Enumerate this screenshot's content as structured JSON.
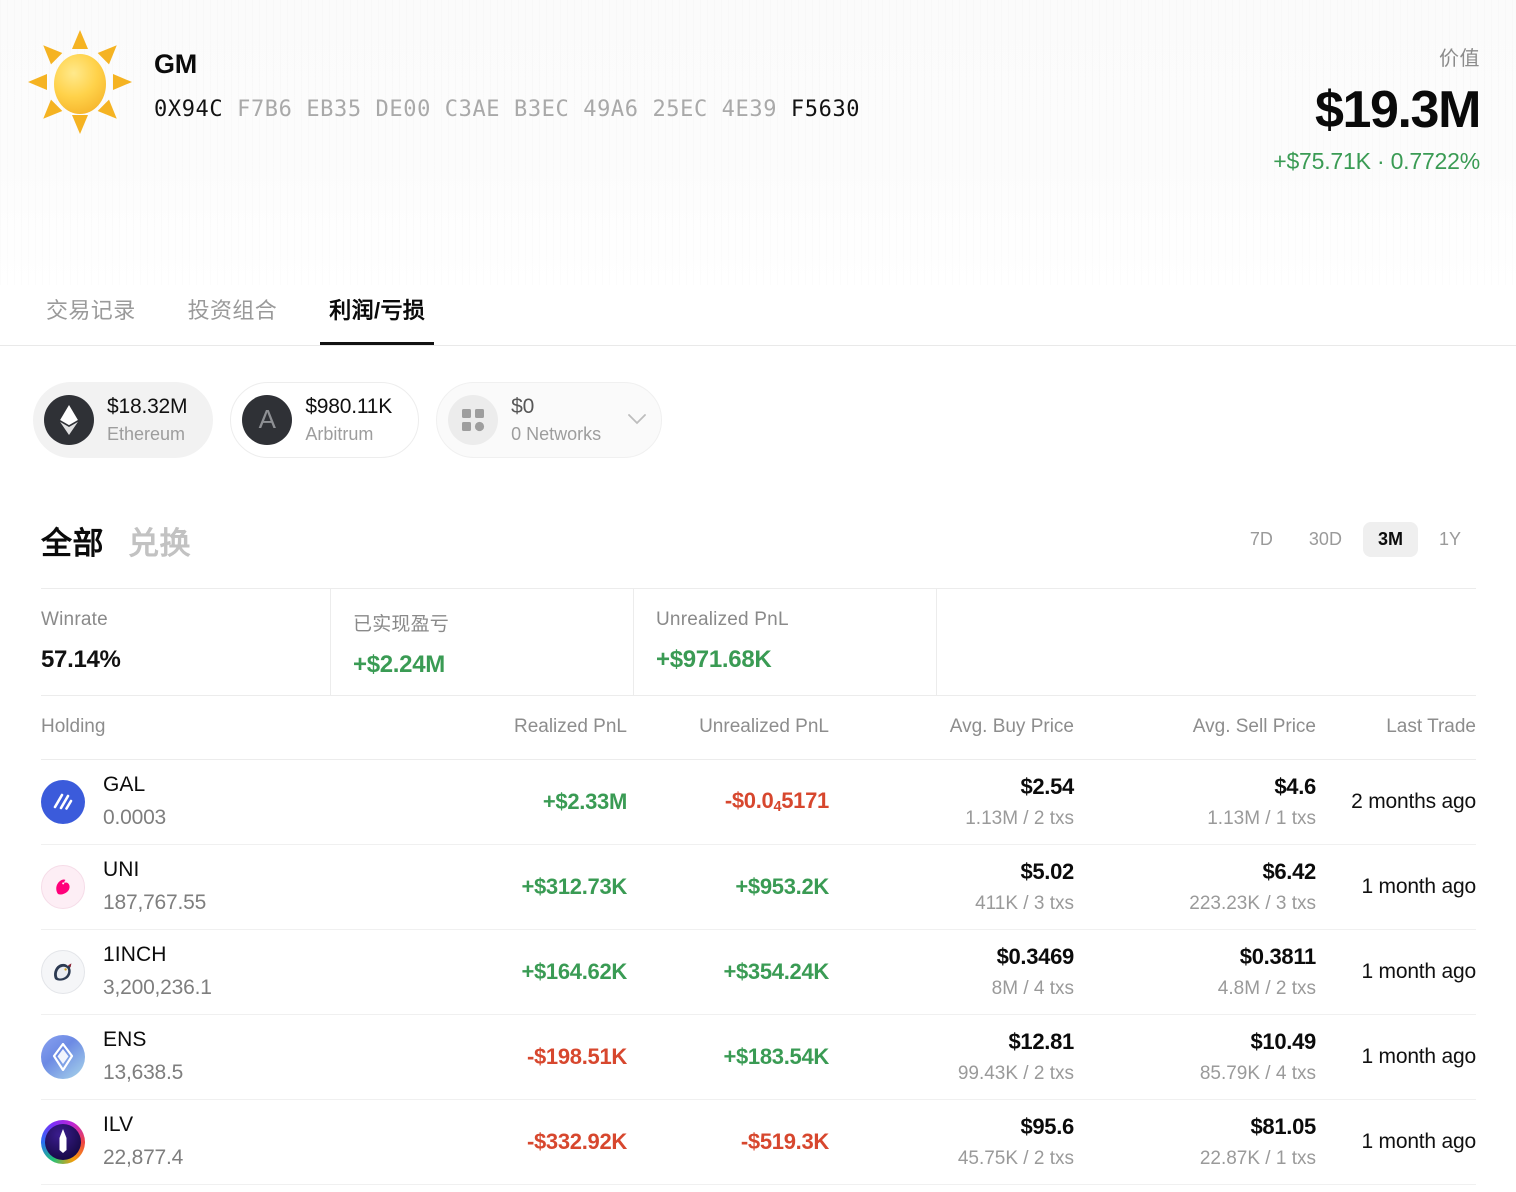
{
  "header": {
    "avatar_icon": "sun-icon",
    "wallet_name": "GM",
    "address_prefix": "0X94C",
    "address_middle": "F7B6 EB35 DE00 C3AE B3EC 49A6 25EC 4E39",
    "address_suffix": "F5630",
    "value_label": "价值",
    "value_amount": "$19.3M",
    "value_change": "+$75.71K · 0.7722%",
    "positive_color": "#3a9b54"
  },
  "tabs": [
    {
      "label": "交易记录",
      "active": false
    },
    {
      "label": "投资组合",
      "active": false
    },
    {
      "label": "利润/亏损",
      "active": true
    }
  ],
  "network_chips": [
    {
      "amount": "$18.32M",
      "network": "Ethereum",
      "icon": "ethereum-icon",
      "selected": true
    },
    {
      "amount": "$980.11K",
      "network": "Arbitrum",
      "icon": "arbitrum-icon",
      "selected": false
    },
    {
      "amount": "$0",
      "network": "0 Networks",
      "icon": "grid-icon",
      "selected": false,
      "chevron": "chevron-down-icon"
    }
  ],
  "filters": {
    "segments": [
      {
        "label": "全部",
        "active": true
      },
      {
        "label": "兑换",
        "active": false
      }
    ],
    "ranges": [
      {
        "label": "7D",
        "active": false
      },
      {
        "label": "30D",
        "active": false
      },
      {
        "label": "3M",
        "active": true
      },
      {
        "label": "1Y",
        "active": false
      }
    ]
  },
  "stats": [
    {
      "label": "Winrate",
      "value": "57.14%",
      "tone": "neutral"
    },
    {
      "label": "已实现盈亏",
      "value": "+$2.24M",
      "tone": "pos"
    },
    {
      "label": "Unrealized PnL",
      "value": "+$971.68K",
      "tone": "pos"
    }
  ],
  "table": {
    "columns": {
      "holding": "Holding",
      "realized": "Realized PnL",
      "unrealized": "Unrealized PnL",
      "avg_buy": "Avg. Buy Price",
      "avg_sell": "Avg. Sell Price",
      "last_trade": "Last Trade"
    },
    "rows": [
      {
        "symbol": "GAL",
        "quantity": "0.0003",
        "icon": "gal-token-icon",
        "realized_pnl": "+$2.33M",
        "realized_tone": "pos",
        "unrealized_pnl": "-$0.0₄5171",
        "unrealized_tone": "neg",
        "avg_buy_price": "$2.54",
        "avg_buy_sub": "1.13M / 2 txs",
        "avg_sell_price": "$4.6",
        "avg_sell_sub": "1.13M / 1 txs",
        "last_trade": "2 months ago"
      },
      {
        "symbol": "UNI",
        "quantity": "187,767.55",
        "icon": "uni-token-icon",
        "realized_pnl": "+$312.73K",
        "realized_tone": "pos",
        "unrealized_pnl": "+$953.2K",
        "unrealized_tone": "pos",
        "avg_buy_price": "$5.02",
        "avg_buy_sub": "411K / 3 txs",
        "avg_sell_price": "$6.42",
        "avg_sell_sub": "223.23K / 3 txs",
        "last_trade": "1 month ago"
      },
      {
        "symbol": "1INCH",
        "quantity": "3,200,236.1",
        "icon": "1inch-token-icon",
        "realized_pnl": "+$164.62K",
        "realized_tone": "pos",
        "unrealized_pnl": "+$354.24K",
        "unrealized_tone": "pos",
        "avg_buy_price": "$0.3469",
        "avg_buy_sub": "8M / 4 txs",
        "avg_sell_price": "$0.3811",
        "avg_sell_sub": "4.8M / 2 txs",
        "last_trade": "1 month ago"
      },
      {
        "symbol": "ENS",
        "quantity": "13,638.5",
        "icon": "ens-token-icon",
        "realized_pnl": "-$198.51K",
        "realized_tone": "neg",
        "unrealized_pnl": "+$183.54K",
        "unrealized_tone": "pos",
        "avg_buy_price": "$12.81",
        "avg_buy_sub": "99.43K / 2 txs",
        "avg_sell_price": "$10.49",
        "avg_sell_sub": "85.79K / 4 txs",
        "last_trade": "1 month ago"
      },
      {
        "symbol": "ILV",
        "quantity": "22,877.4",
        "icon": "ilv-token-icon",
        "realized_pnl": "-$332.92K",
        "realized_tone": "neg",
        "unrealized_pnl": "-$519.3K",
        "unrealized_tone": "neg",
        "avg_buy_price": "$95.6",
        "avg_buy_sub": "45.75K / 2 txs",
        "avg_sell_price": "$81.05",
        "avg_sell_sub": "22.87K / 1 txs",
        "last_trade": "1 month ago"
      }
    ]
  },
  "colors": {
    "positive": "#3a9b54",
    "negative": "#d7472e",
    "accent_gal": "#3b5bdb",
    "accent_uni": "#ff007a"
  }
}
